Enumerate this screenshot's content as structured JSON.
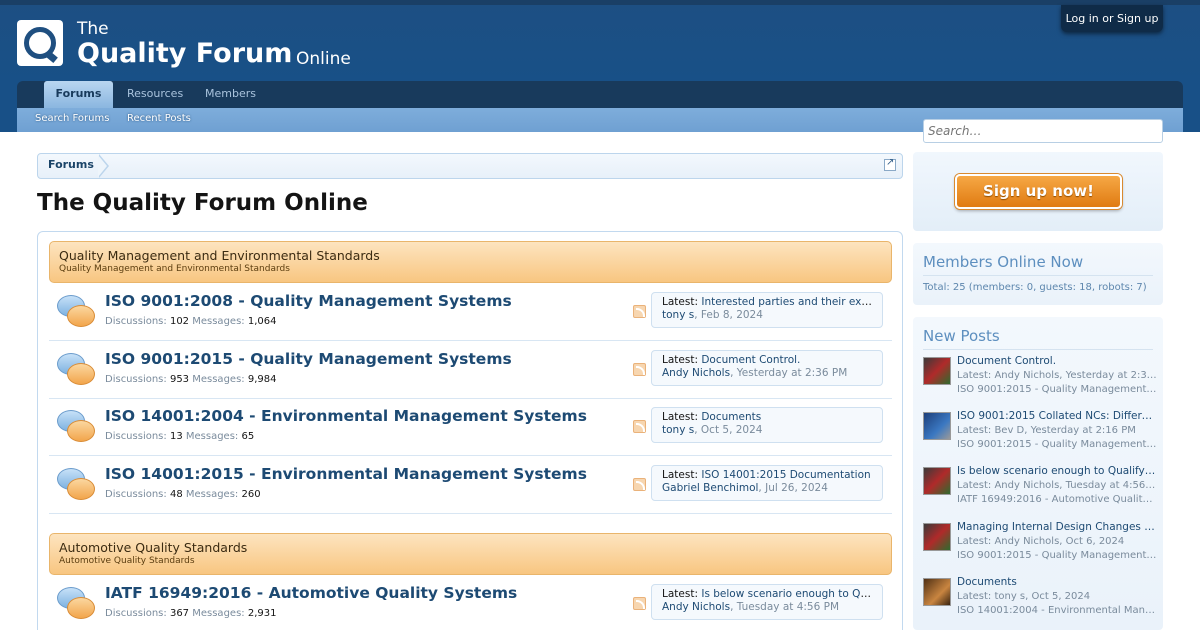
{
  "site": {
    "logo_the": "The",
    "logo_main": "Quality Forum",
    "logo_online": "Online",
    "login": "Log in or Sign up"
  },
  "nav": {
    "tabs": [
      "Forums",
      "Resources",
      "Members"
    ],
    "sub": [
      "Search Forums",
      "Recent Posts"
    ]
  },
  "breadcrumb": {
    "item": "Forums"
  },
  "page": {
    "title": "The Quality Forum Online"
  },
  "categories": [
    {
      "title": "Quality Management and Environmental Standards",
      "desc": "Quality Management and Environmental Standards",
      "nodes": [
        {
          "title": "ISO 9001:2008 - Quality Management Systems",
          "discussions_label": "Discussions:",
          "discussions": "102",
          "messages_label": "Messages:",
          "messages": "1,064",
          "latest_label": "Latest:",
          "latest_title": "Interested parties and their expe…",
          "latest_author": "tony s",
          "latest_date": "Feb 8, 2024"
        },
        {
          "title": "ISO 9001:2015 - Quality Management Systems",
          "discussions_label": "Discussions:",
          "discussions": "953",
          "messages_label": "Messages:",
          "messages": "9,984",
          "latest_label": "Latest:",
          "latest_title": "Document Control.",
          "latest_author": "Andy Nichols",
          "latest_date": "Yesterday at 2:36 PM"
        },
        {
          "title": "ISO 14001:2004 - Environmental Management Systems",
          "discussions_label": "Discussions:",
          "discussions": "13",
          "messages_label": "Messages:",
          "messages": "65",
          "latest_label": "Latest:",
          "latest_title": "Documents",
          "latest_author": "tony s",
          "latest_date": "Oct 5, 2024"
        },
        {
          "title": "ISO 14001:2015 - Environmental Management Systems",
          "discussions_label": "Discussions:",
          "discussions": "48",
          "messages_label": "Messages:",
          "messages": "260",
          "latest_label": "Latest:",
          "latest_title": "ISO 14001:2015 Documentation",
          "latest_author": "Gabriel Benchimol",
          "latest_date": "Jul 26, 2024"
        }
      ]
    },
    {
      "title": "Automotive Quality Standards",
      "desc": "Automotive Quality Standards",
      "nodes": [
        {
          "title": "IATF 16949:2016 - Automotive Quality Systems",
          "discussions_label": "Discussions:",
          "discussions": "367",
          "messages_label": "Messages:",
          "messages": "2,931",
          "latest_label": "Latest:",
          "latest_title": "Is below scenario enough to Qual…",
          "latest_author": "Andy Nichols",
          "latest_date": "Tuesday at 4:56 PM"
        }
      ]
    }
  ],
  "sidebar": {
    "search_placeholder": "Search…",
    "signup": "Sign up now!",
    "members_online": {
      "title": "Members Online Now",
      "total": "Total: 25 (members: 0, guests: 18, robots: 7)"
    },
    "new_posts": {
      "title": "New Posts",
      "items": [
        {
          "title": "Document Control.",
          "meta": "Latest: Andy Nichols, Yesterday at 2:3…",
          "forum": "ISO 9001:2015 - Quality Management …"
        },
        {
          "title": "ISO 9001:2015 Collated NCs: Different…",
          "meta": "Latest: Bev D, Yesterday at 2:16 PM",
          "forum": "ISO 9001:2015 - Quality Management …"
        },
        {
          "title": "Is below scenario enough to Qualify f…",
          "meta": "Latest: Andy Nichols, Tuesday at 4:56 …",
          "forum": "IATF 16949:2016 - Automotive Quality…"
        },
        {
          "title": "Managing Internal Design Changes for …",
          "meta": "Latest: Andy Nichols, Oct 6, 2024",
          "forum": "ISO 9001:2015 - Quality Management …"
        },
        {
          "title": "Documents",
          "meta": "Latest: tony s, Oct 5, 2024",
          "forum": "ISO 14001:2004 - Environmental Mana…"
        }
      ]
    }
  }
}
